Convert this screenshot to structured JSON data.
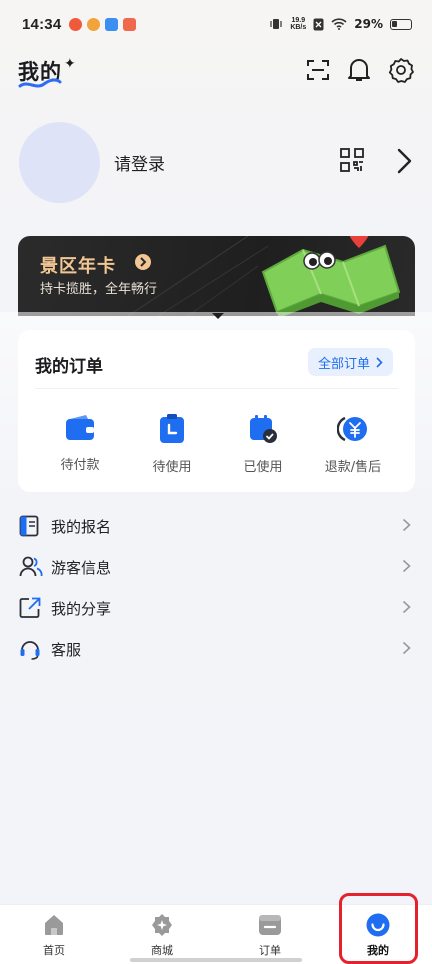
{
  "status_bar": {
    "time": "14:34",
    "net_speed_value": "19.9",
    "net_speed_unit": "KB/s",
    "battery_text": "29%"
  },
  "header": {
    "title": "我的",
    "sparkle": "✦"
  },
  "profile": {
    "login_text": "请登录"
  },
  "banner": {
    "title": "景区年卡",
    "subtitle": "持卡揽胜，全年畅行",
    "accent_color": "#f2c794"
  },
  "orders": {
    "title": "我的订单",
    "all_label": "全部订单",
    "items": [
      {
        "label": "待付款",
        "icon": "wallet-icon"
      },
      {
        "label": "待使用",
        "icon": "clock-ticket-icon"
      },
      {
        "label": "已使用",
        "icon": "calendar-check-icon"
      },
      {
        "label": "退款/售后",
        "icon": "yuan-refund-icon"
      }
    ]
  },
  "menu": {
    "items": [
      {
        "label": "我的报名",
        "icon": "signup-doc-icon"
      },
      {
        "label": "游客信息",
        "icon": "visitors-icon"
      },
      {
        "label": "我的分享",
        "icon": "share-icon"
      },
      {
        "label": "客服",
        "icon": "headset-icon"
      }
    ]
  },
  "tabbar": {
    "items": [
      {
        "label": "首页",
        "icon": "home-icon"
      },
      {
        "label": "商城",
        "icon": "mall-icon"
      },
      {
        "label": "订单",
        "icon": "orders-icon"
      },
      {
        "label": "我的",
        "icon": "profile-smile-icon",
        "active": true
      }
    ],
    "active_color": "#1f6df0"
  }
}
